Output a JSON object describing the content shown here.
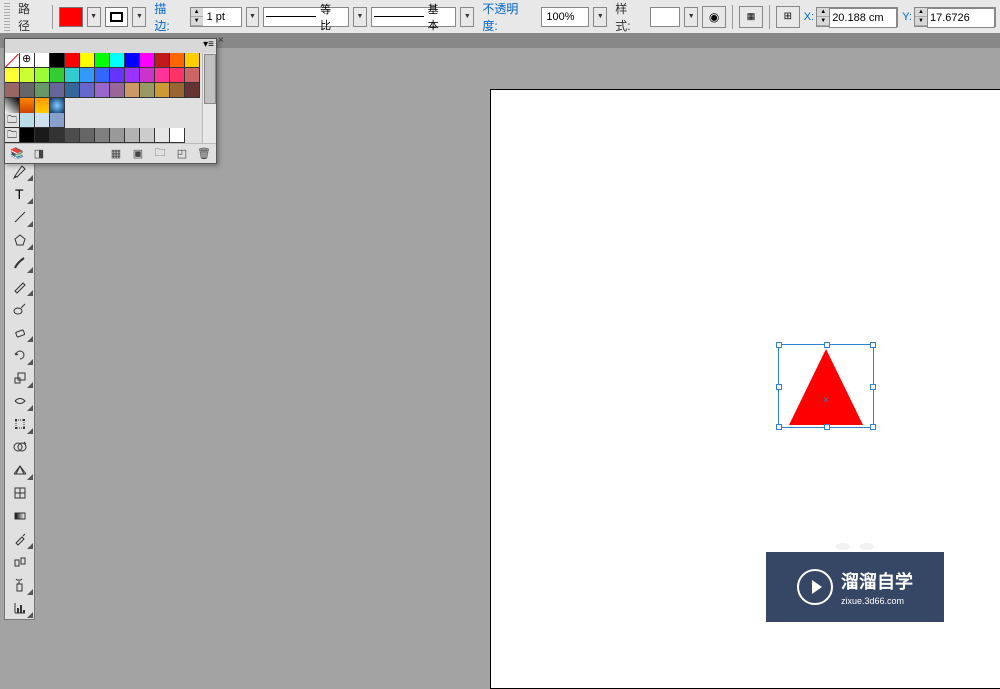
{
  "optionsBar": {
    "selectionMode": "路径",
    "fill_color": "#ff0000",
    "stroke_label": "描边:",
    "stroke_weight": "1 pt",
    "line_profile": "等比",
    "brush_def": "基本",
    "opacity_label": "不透明度:",
    "opacity_value": "100%",
    "style_label": "样式:",
    "x_label": "X:",
    "x_value": "20.188 cm",
    "y_label": "Y:",
    "y_value": "17.6726"
  },
  "swatches": {
    "rows": [
      [
        "none",
        "registration",
        "#ffffff",
        "#000000",
        "#ff0000",
        "#ffff00",
        "#00ff00",
        "#00ffff",
        "#0000ff",
        "#ff00ff",
        "#c01a1a",
        "#ff6600",
        "#ffcc00"
      ],
      [
        "#ffff33",
        "#ccff33",
        "#99ff33",
        "#33cc33",
        "#33cccc",
        "#3399ff",
        "#3366ff",
        "#6633ff",
        "#9933ff",
        "#cc33cc",
        "#ff3399",
        "#ff3366",
        "#cc6666"
      ],
      [
        "#996666",
        "#666666",
        "#669966",
        "#666699",
        "#336699",
        "#6666cc",
        "#9966cc",
        "#996699",
        "#cc9966",
        "#999966",
        "#cc9933",
        "#996633",
        "#663333"
      ]
    ],
    "gradients": [
      "linear-gradient(45deg,#fff,#000)",
      "linear-gradient(#ff8800,#cc4400)",
      "linear-gradient(#ff9900,#ffcc00)",
      "radial-gradient(circle,#88ccff,#003366)"
    ],
    "tints_row": [
      "#bbdde8",
      "#d0e0ee",
      "#88a0cc"
    ],
    "grays": [
      "#000000",
      "#1a1a1a",
      "#333333",
      "#4d4d4d",
      "#666666",
      "#808080",
      "#999999",
      "#b3b3b3",
      "#cccccc",
      "#e6e6e6",
      "#ffffff"
    ]
  },
  "watermark": {
    "title": "溜溜自学",
    "url": "zixue.3d66.com"
  }
}
